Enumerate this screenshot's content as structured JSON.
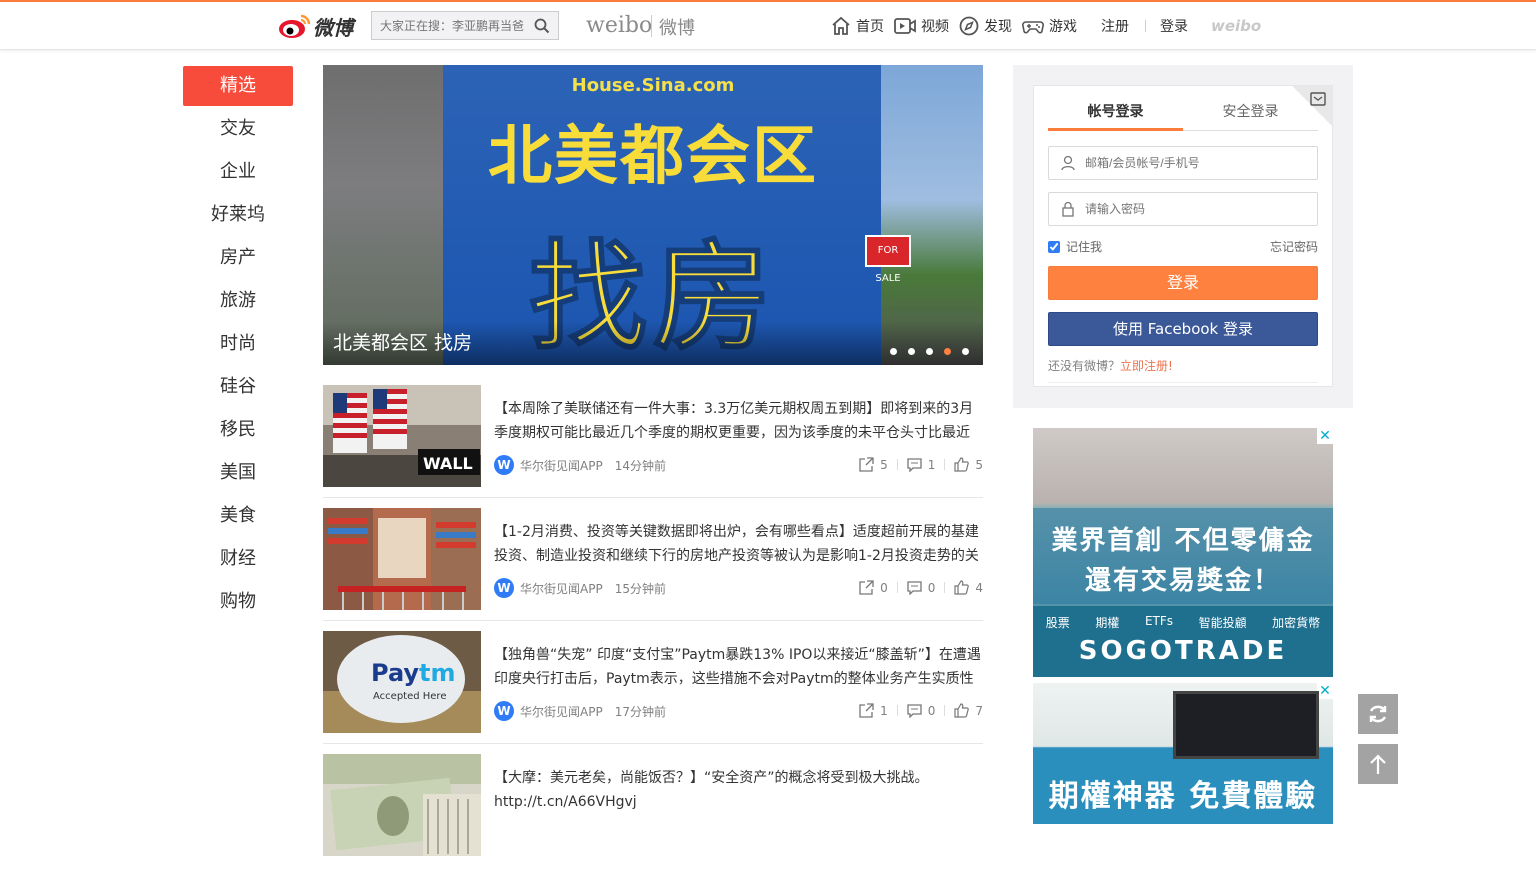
{
  "header": {
    "logo_text": "微博",
    "search_placeholder": "大家正在搜：李亚鹏再当爸",
    "brand_en": "weibo",
    "brand_cn": "微博",
    "nav": [
      {
        "label": "首页",
        "icon": "home-icon"
      },
      {
        "label": "视频",
        "icon": "video-icon"
      },
      {
        "label": "发现",
        "icon": "compass-icon"
      },
      {
        "label": "游戏",
        "icon": "gamepad-icon"
      }
    ],
    "register": "注册",
    "login": "登录",
    "mini_logo": "weibo"
  },
  "sidebar": {
    "items": [
      {
        "label": "精选",
        "active": true
      },
      {
        "label": "交友"
      },
      {
        "label": "企业"
      },
      {
        "label": "好莱坞"
      },
      {
        "label": "房产"
      },
      {
        "label": "旅游"
      },
      {
        "label": "时尚"
      },
      {
        "label": "硅谷"
      },
      {
        "label": "移民"
      },
      {
        "label": "美国"
      },
      {
        "label": "美食"
      },
      {
        "label": "财经"
      },
      {
        "label": "购物"
      }
    ]
  },
  "banner": {
    "site": "House.Sina.com",
    "headline": "北美都会区",
    "subheadline": "找房",
    "sign": "FOR SALE",
    "caption": "北美都会区 找房",
    "slides": 5,
    "active_slide": 4
  },
  "feed": [
    {
      "text": "【本周除了美联储还有一件大事：3.3万亿美元期权周五到期】即将到来的3月季度期权可能比最近几个季度的期权更重要，因为该季度的未平仓头寸比最近几个季度都要多……",
      "source": "华尔街见闻APP",
      "time": "14分钟前",
      "reposts": "5",
      "comments": "1",
      "likes": "5",
      "thumb": "wall-street-flags"
    },
    {
      "text": "【1-2月消费、投资等关键数据即将出炉，会有哪些看点】适度超前开展的基建投资、制造业投资和继续下行的房地产投资等被认为是影响1-2月投资走势的关键因素……",
      "source": "华尔街见闻APP",
      "time": "15分钟前",
      "reposts": "0",
      "comments": "0",
      "likes": "4",
      "thumb": "shopping-cart"
    },
    {
      "text": "【独角兽“失宠” 印度“支付宝”Paytm暴跌13% IPO以来接近“膝盖斩”】在遭遇印度央行打击后，Paytm表示，这些措施不会对Paytm的整体业务产生实质性的影响……",
      "source": "华尔街见闻APP",
      "time": "17分钟前",
      "reposts": "1",
      "comments": "0",
      "likes": "7",
      "thumb": "paytm-balloon"
    },
    {
      "text": "【大摩：美元老矣，尚能饭否？】“安全资产”的概念将受到极大挑战。http://t.cn/A66VHgvj",
      "thumb": "dollar-bills"
    }
  ],
  "login": {
    "tab_account": "帐号登录",
    "tab_secure": "安全登录",
    "username_placeholder": "邮箱/会员帐号/手机号",
    "password_placeholder": "请输入密码",
    "remember": "记住我",
    "forgot": "忘记密码",
    "login_button": "登录",
    "facebook_button": "使用 Facebook 登录",
    "no_account": "还没有微博？",
    "register_link": "立即注册!"
  },
  "ads": [
    {
      "line1": "業界首創  不但零傭金",
      "line2": "還有交易獎金！",
      "categories": [
        "股票",
        "期權",
        "ETFs",
        "智能投顧",
        "加密貨幣"
      ],
      "brand": "SOGOTRADE"
    },
    {
      "line1": "期權神器  免費體驗"
    }
  ],
  "colors": {
    "accent_orange": "#ff8140",
    "active_red": "#f74b3b",
    "facebook_blue": "#3b5998",
    "link_orange": "#eb7350"
  }
}
